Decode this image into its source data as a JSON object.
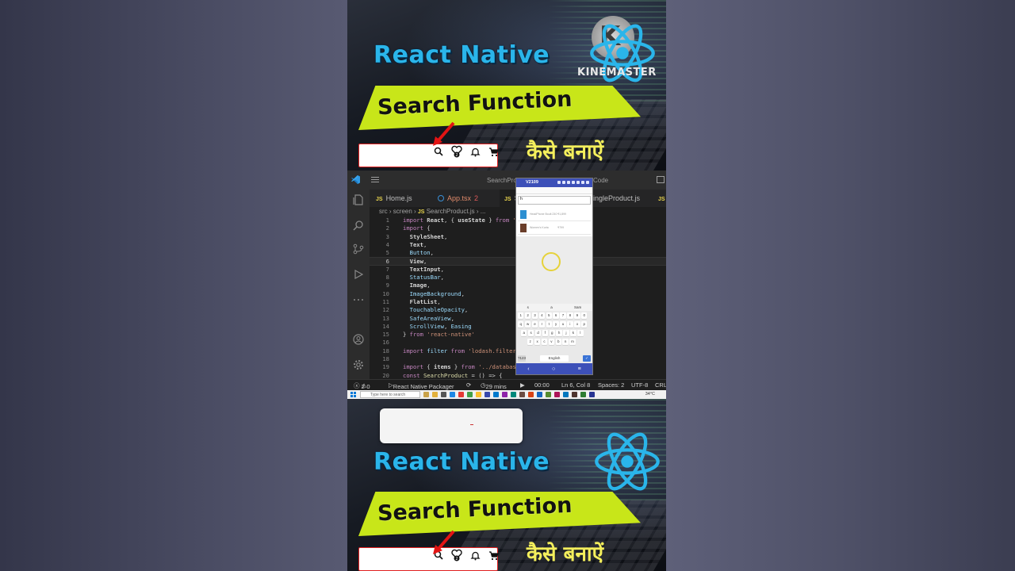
{
  "banner": {
    "title": "React Native",
    "subtitle": "Search Function",
    "hindi": "कैसे बनाऐं",
    "watermark": "KINEMASTER",
    "cart_count": "2"
  },
  "vscode": {
    "window_title": "SearchPro",
    "window_title_tail": "Code",
    "tabs": [
      {
        "icon": "JS",
        "label": "Home.js"
      },
      {
        "icon": "tsx",
        "label": "App.tsx",
        "badge": "2"
      },
      {
        "icon": "JS",
        "label": "Se"
      },
      {
        "icon": "",
        "label": "ingleProduct.js"
      },
      {
        "icon": "JS",
        "label": ""
      }
    ],
    "breadcrumb": {
      "p1": "src",
      "p2": "screen",
      "icon": "JS",
      "file": "SearchProduct.js",
      "more": "..."
    },
    "code_lines": [
      {
        "n": "1",
        "html": "<span class='kw'>import</span> <span class='wh'>React</span>, { <span class='wh'>useState</span> } <span class='kw'>from</span> <span class='str'>'r</span>"
      },
      {
        "n": "2",
        "html": "<span class='kw'>import</span> {"
      },
      {
        "n": "3",
        "html": "  <span class='wh'>StyleSheet</span>,"
      },
      {
        "n": "4",
        "html": "  <span class='wh'>Text</span>,"
      },
      {
        "n": "5",
        "html": "  <span class='id'>Button</span>,"
      },
      {
        "n": "6",
        "html": "  <span class='wh'>View</span>,",
        "current": true
      },
      {
        "n": "7",
        "html": "  <span class='wh'>TextInput</span>,"
      },
      {
        "n": "8",
        "html": "  <span class='id'>StatusBar</span>,"
      },
      {
        "n": "9",
        "html": "  <span class='wh'>Image</span>,"
      },
      {
        "n": "10",
        "html": "  <span class='id'>ImageBackground</span>,"
      },
      {
        "n": "11",
        "html": "  <span class='wh'>FlatList</span>,"
      },
      {
        "n": "12",
        "html": "  <span class='id'>TouchableOpacity</span>,"
      },
      {
        "n": "13",
        "html": "  <span class='id'>SafeAreaView</span>,"
      },
      {
        "n": "14",
        "html": "  <span class='id'>ScrollView</span>, <span class='id'>Easing</span>"
      },
      {
        "n": "15",
        "html": "} <span class='kw'>from</span> <span class='str'>'react-native'</span>"
      },
      {
        "n": "16",
        "html": ""
      },
      {
        "n": "18",
        "html": "<span class='kw'>import</span> <span class='id'>filter</span> <span class='kw'>from</span> <span class='str'>'lodash.filter</span>"
      },
      {
        "n": "18",
        "html": ""
      },
      {
        "n": "19",
        "html": "<span class='kw'>import</span> { <span class='wh'>items</span> } <span class='kw'>from</span> <span class='str'>'../database</span>"
      },
      {
        "n": "20",
        "html": "<span class='kw'>const</span> <span class='fn'>SearchProduct</span> = () => {"
      }
    ],
    "status": {
      "errors": "2",
      "warnings": "0",
      "packager": "React Native Packager",
      "time": "29 mins",
      "clock": "00:00",
      "position": "Ln 6, Col 8",
      "spaces": "Spaces: 2",
      "encoding": "UTF-8",
      "eol": "CRLF"
    },
    "taskbar": {
      "search_placeholder": "Type here to search",
      "temp": "34°C"
    }
  },
  "phone": {
    "device": "V2109",
    "search_value": "h",
    "results": [
      {
        "name": "HeadPhone Boult Z40",
        "price": "₹1,899"
      },
      {
        "name": "Women's Kurta",
        "price": "₹799"
      }
    ],
    "keyboard": {
      "suggestions": [
        "s",
        "a",
        "Sam"
      ],
      "row1": [
        "1",
        "2",
        "3",
        "4",
        "5",
        "6",
        "7",
        "8",
        "9",
        "0"
      ],
      "row2": [
        "q",
        "w",
        "e",
        "r",
        "t",
        "y",
        "u",
        "i",
        "o",
        "p"
      ],
      "row3": [
        "a",
        "s",
        "d",
        "f",
        "g",
        "h",
        "j",
        "k",
        "l"
      ],
      "row4": [
        "z",
        "x",
        "c",
        "v",
        "b",
        "n",
        "m"
      ],
      "sym": "?123",
      "space": "English"
    }
  },
  "colors": {
    "accent_blue": "#2ab5ea",
    "band_yellow": "#c8e619",
    "hindi_yellow": "#f4ef5c",
    "vscode_bg": "#1e1e1e",
    "phone_blue": "#3d50b8"
  }
}
